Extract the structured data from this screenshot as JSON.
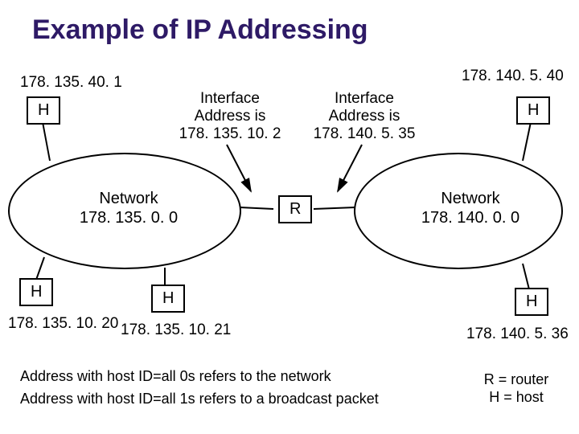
{
  "title": "Example of IP Addressing",
  "ip_top_left": "178. 135. 40. 1",
  "ip_top_right": "178. 140. 5. 40",
  "interface_left_l1": "Interface",
  "interface_left_l2": "Address is",
  "interface_left_l3": "178. 135. 10. 2",
  "interface_right_l1": "Interface",
  "interface_right_l2": "Address is",
  "interface_right_l3": "178. 140. 5. 35",
  "h_label": "H",
  "r_label": "R",
  "network_left_l1": "Network",
  "network_left_l2": "178. 135. 0. 0",
  "network_right_l1": "Network",
  "network_right_l2": "178. 140. 0. 0",
  "ip_bottom_1": "178. 135. 10. 20",
  "ip_bottom_2": "178. 135. 10. 21",
  "ip_bottom_3": "178. 140. 5. 36",
  "footnote_1": "Address with host ID=all 0s refers to the network",
  "footnote_2": "Address with host ID=all 1s refers to a broadcast packet",
  "legend_l1": "R = router",
  "legend_l2": "H = host"
}
